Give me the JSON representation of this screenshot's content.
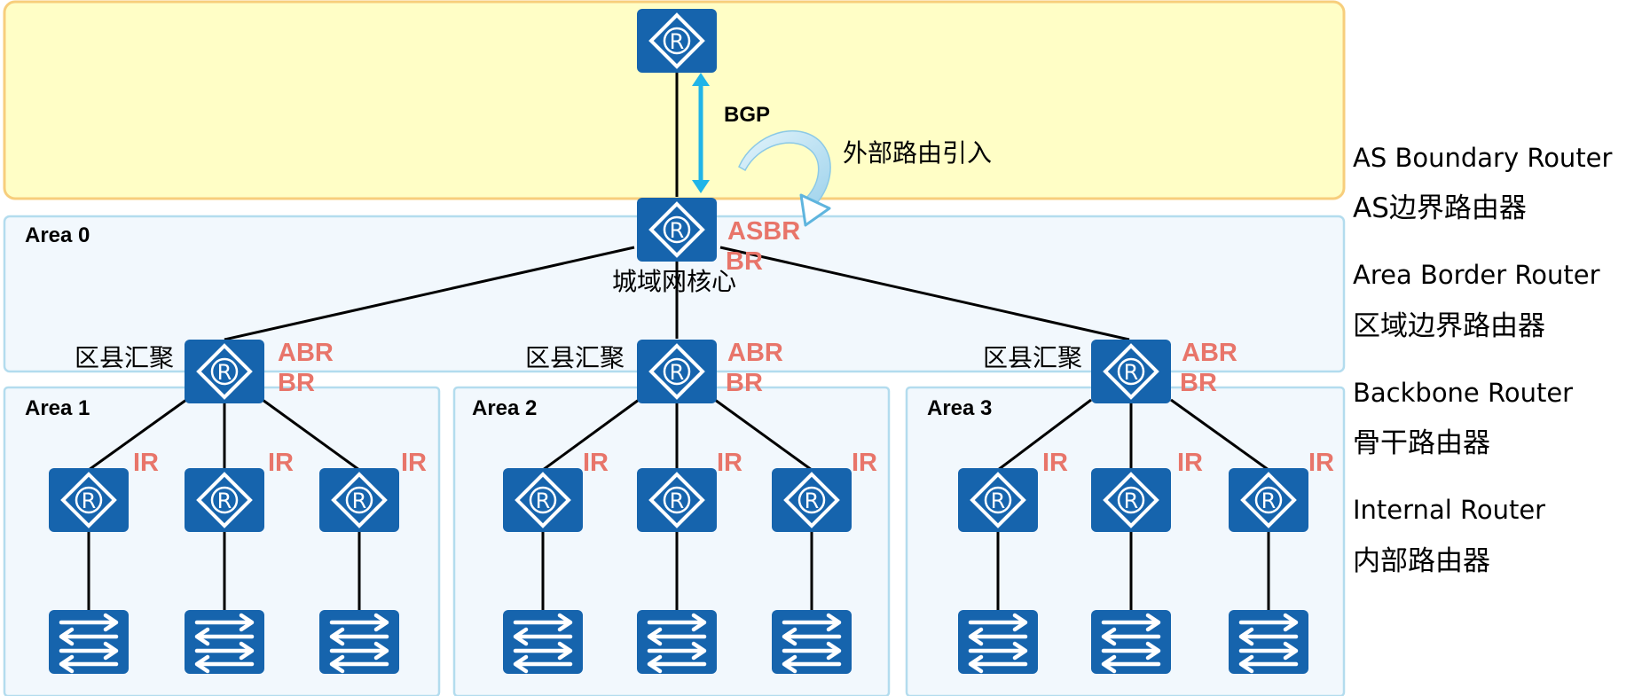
{
  "colors": {
    "device": "#1664ad",
    "role_label": "#e8756a",
    "bgp_arrow": "#1fb4e8",
    "as_zone_fill": "#fffec6",
    "as_zone_border": "#f7ce7c",
    "area_fill": "#f2f8fd",
    "area_border": "#b3dcee",
    "link": "#000000"
  },
  "bgp": {
    "label": "BGP"
  },
  "external_import": {
    "label": "外部路由引入"
  },
  "areas": {
    "area0": "Area 0",
    "area1": "Area 1",
    "area2": "Area 2",
    "area3": "Area 3"
  },
  "core": {
    "role_asbr": "ASBR",
    "role_br": "BR",
    "caption": "城域网核心"
  },
  "aggregation": [
    {
      "caption": "区县汇聚",
      "role_abr": "ABR",
      "role_br": "BR"
    },
    {
      "caption": "区县汇聚",
      "role_abr": "ABR",
      "role_br": "BR"
    },
    {
      "caption": "区县汇聚",
      "role_abr": "ABR",
      "role_br": "BR"
    }
  ],
  "internal_role": "IR",
  "legend": [
    {
      "en": "AS Boundary Router",
      "cn": "AS边界路由器"
    },
    {
      "en": "Area Border Router",
      "cn": "区域边界路由器"
    },
    {
      "en": "Backbone Router",
      "cn": "骨干路由器"
    },
    {
      "en": "Internal Router",
      "cn": "内部路由器"
    }
  ],
  "icons": {
    "router": "router-icon",
    "switch": "switch-icon"
  }
}
